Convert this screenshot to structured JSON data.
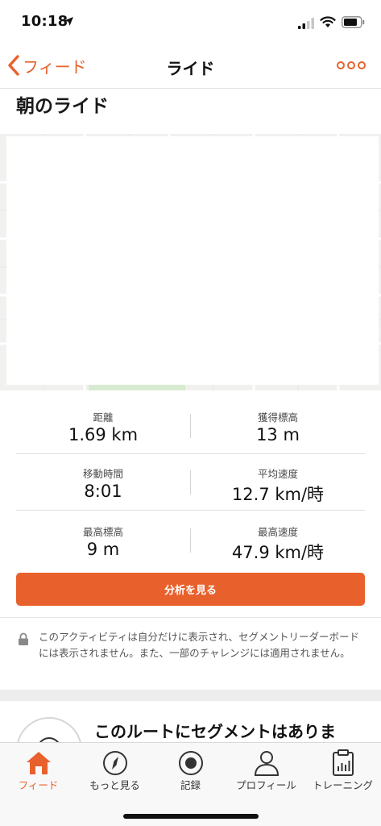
{
  "status_bar": {
    "time": "10:18"
  },
  "nav": {
    "back_label": "フィード",
    "title": "ライド"
  },
  "activity": {
    "title": "朝のライド"
  },
  "stats": [
    {
      "left": {
        "label": "距離",
        "value": "1.69 km"
      },
      "right": {
        "label": "獲得標高",
        "value": "13 m"
      }
    },
    {
      "left": {
        "label": "移動時間",
        "value": "8:01"
      },
      "right": {
        "label": "平均速度",
        "value": "12.7 km/時"
      }
    },
    {
      "left": {
        "label": "最高標高",
        "value": "9 m"
      },
      "right": {
        "label": "最高速度",
        "value": "47.9 km/時"
      }
    }
  ],
  "analyze_button": {
    "label": "分析を見る"
  },
  "privacy_notice": {
    "text": "このアクティビティは自分だけに表示され、セグメントリーダーボードには表示されません。また、一部のチャレンジには適用されません。"
  },
  "segments": {
    "title": "このルートにセグメントはありま"
  },
  "tab_bar": {
    "items": [
      {
        "label": "フィード",
        "icon": "home-icon",
        "active": true
      },
      {
        "label": "もっと見る",
        "icon": "compass-icon",
        "active": false
      },
      {
        "label": "記録",
        "icon": "record-icon",
        "active": false
      },
      {
        "label": "プロフィール",
        "icon": "profile-icon",
        "active": false
      },
      {
        "label": "トレーニング",
        "icon": "clipboard-icon",
        "active": false
      }
    ]
  },
  "colors": {
    "accent": "#e8612c",
    "text": "#111111",
    "muted": "#555555",
    "tab_bar_bg": "#f8f8f8"
  }
}
